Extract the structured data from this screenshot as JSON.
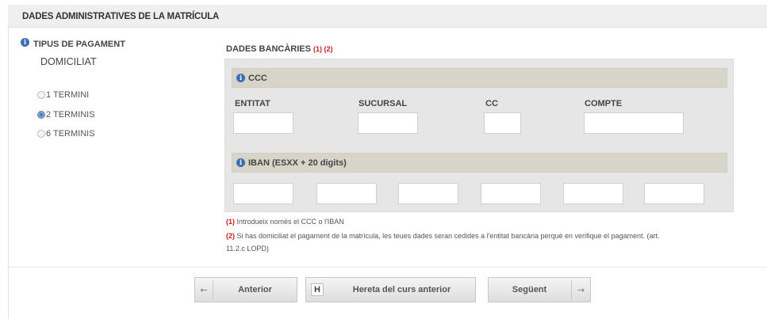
{
  "section": {
    "title": "DADES ADMINISTRATIVES DE LA MATRÍCULA"
  },
  "payment": {
    "title": "TIPUS DE PAGAMENT",
    "value": "DOMICILIAT",
    "options": [
      {
        "label": "1 TERMINI",
        "checked": false
      },
      {
        "label": "2 TERMINIS",
        "checked": true
      },
      {
        "label": "6 TERMINIS",
        "checked": false
      }
    ]
  },
  "bank": {
    "title": "DADES BANCÀRIES",
    "refs": "(1) (2)",
    "ccc": {
      "label": "CCC",
      "columns": [
        "ENTITAT",
        "SUCURSAL",
        "CC",
        "COMPTE"
      ],
      "values": [
        "",
        "",
        "",
        ""
      ]
    },
    "iban": {
      "label": "IBAN (ESXX + 20 digits)",
      "values": [
        "",
        "",
        "",
        "",
        "",
        ""
      ]
    }
  },
  "notes": [
    {
      "ref": "(1)",
      "text": "Introdueix només el CCC o l'IBAN"
    },
    {
      "ref": "(2)",
      "text": "Si has domiciliat el pagament de la matrícula, les teues dades seran cedides a l'entitat bancària perquè en verifique el pagament. (art.",
      "text2": "11.2.c LOPD)"
    }
  ],
  "buttons": {
    "previous": {
      "arrow": "←",
      "label": "Anterior"
    },
    "inherit": {
      "key": "H",
      "label": "Hereta del curs anterior"
    },
    "next": {
      "label": "Següent",
      "arrow": "→"
    }
  },
  "colors": {
    "info": "#3b6eb5",
    "reference": "#cc2020",
    "bar": "#d7d5c9",
    "panel": "#e6e6e6"
  }
}
